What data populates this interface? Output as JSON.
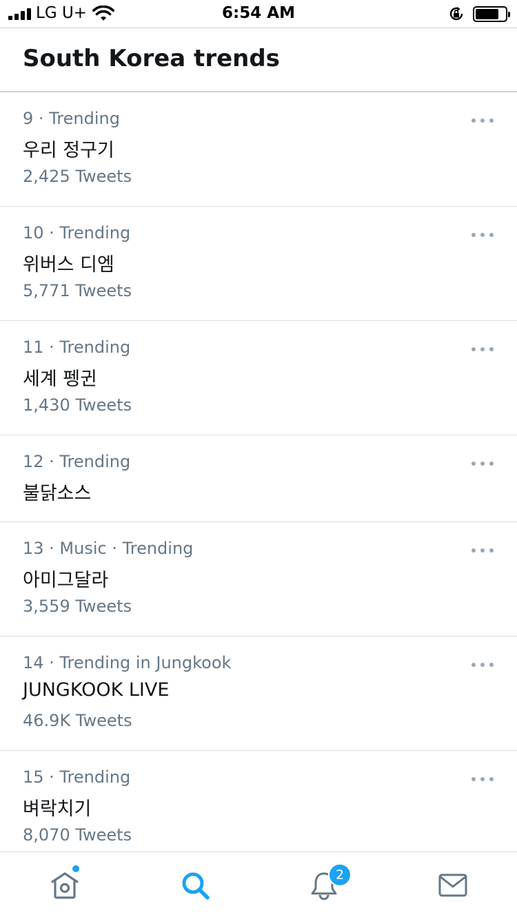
{
  "status_bar": {
    "carrier": "LG U+",
    "time": "6:54 AM",
    "signal_bars": 4,
    "battery_level": 0.75
  },
  "header": {
    "title": "South Korea trends"
  },
  "trends": [
    {
      "meta": "9 · Trending",
      "name": "우리 정구기",
      "count": "2,425 Tweets"
    },
    {
      "meta": "10 · Trending",
      "name": "위버스 디엠",
      "count": "5,771 Tweets"
    },
    {
      "meta": "11 · Trending",
      "name": "세계 펭귄",
      "count": "1,430 Tweets"
    },
    {
      "meta": "12 · Trending",
      "name": "불닭소스",
      "count": ""
    },
    {
      "meta": "13 · Music · Trending",
      "name": "아미그달라",
      "count": "3,559 Tweets"
    },
    {
      "meta": "14 · Trending in Jungkook",
      "name": "JUNGKOOK LIVE",
      "count": "46.9K Tweets"
    },
    {
      "meta": "15 · Trending",
      "name": "벼락치기",
      "count": "8,070 Tweets"
    }
  ],
  "tab_bar": {
    "tabs": [
      {
        "icon": "home-icon",
        "active": false,
        "indicator": "dot"
      },
      {
        "icon": "search-icon",
        "active": true
      },
      {
        "icon": "bell-icon",
        "active": false,
        "badge": "2"
      },
      {
        "icon": "mail-icon",
        "active": false
      }
    ]
  },
  "colors": {
    "accent": "#1da1f2",
    "text_primary": "#14171a",
    "text_secondary": "#657786",
    "divider": "#d8dfe5",
    "icon_gray": "#657786"
  }
}
